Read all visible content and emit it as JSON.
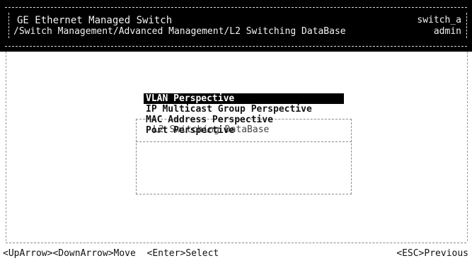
{
  "header": {
    "title": "GE Ethernet Managed Switch",
    "path": "/Switch Management/Advanced Management/L2 Switching DataBase",
    "hostname": "switch_a",
    "user": "admin"
  },
  "menu": {
    "title": "L2 Switching DataBase",
    "items": [
      {
        "label": "VLAN Perspective",
        "selected": true
      },
      {
        "label": "IP Multicast Group Perspective",
        "selected": false
      },
      {
        "label": "MAC Address Perspective",
        "selected": false
      },
      {
        "label": "Port Perspective",
        "selected": false
      }
    ]
  },
  "footer": {
    "hint_nav": "<UpArrow><DownArrow>Move  <Enter>Select",
    "hint_back": "<ESC>Previous"
  },
  "colors": {
    "background": "#ffffff",
    "header_bg": "#000000",
    "selection_bg": "#000000",
    "selection_fg": "#ffffff",
    "text": "#111111"
  }
}
